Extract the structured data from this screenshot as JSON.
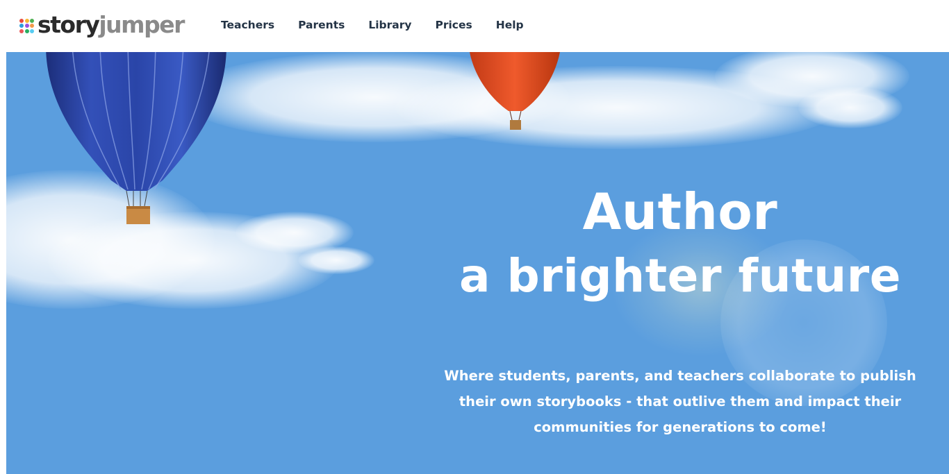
{
  "brand": {
    "name_part1": "story",
    "name_part2": "jumper",
    "dot_colors": [
      "#e94b3c",
      "#f7b733",
      "#4caf50",
      "#2d9cdb",
      "#9b51e0",
      "#f2994a",
      "#eb5757",
      "#27ae60",
      "#56ccf2"
    ]
  },
  "nav": {
    "items": [
      {
        "label": "Teachers"
      },
      {
        "label": "Parents"
      },
      {
        "label": "Library"
      },
      {
        "label": "Prices"
      },
      {
        "label": "Help"
      }
    ]
  },
  "hero": {
    "title_line1": "Author",
    "title_line2": "a brighter future",
    "subtitle_lines": [
      "Where students, parents, and teachers collaborate to publish",
      "their own storybooks - that outlive them and impact their",
      "communities for generations to come!"
    ],
    "sky_color": "#5b9ede"
  }
}
